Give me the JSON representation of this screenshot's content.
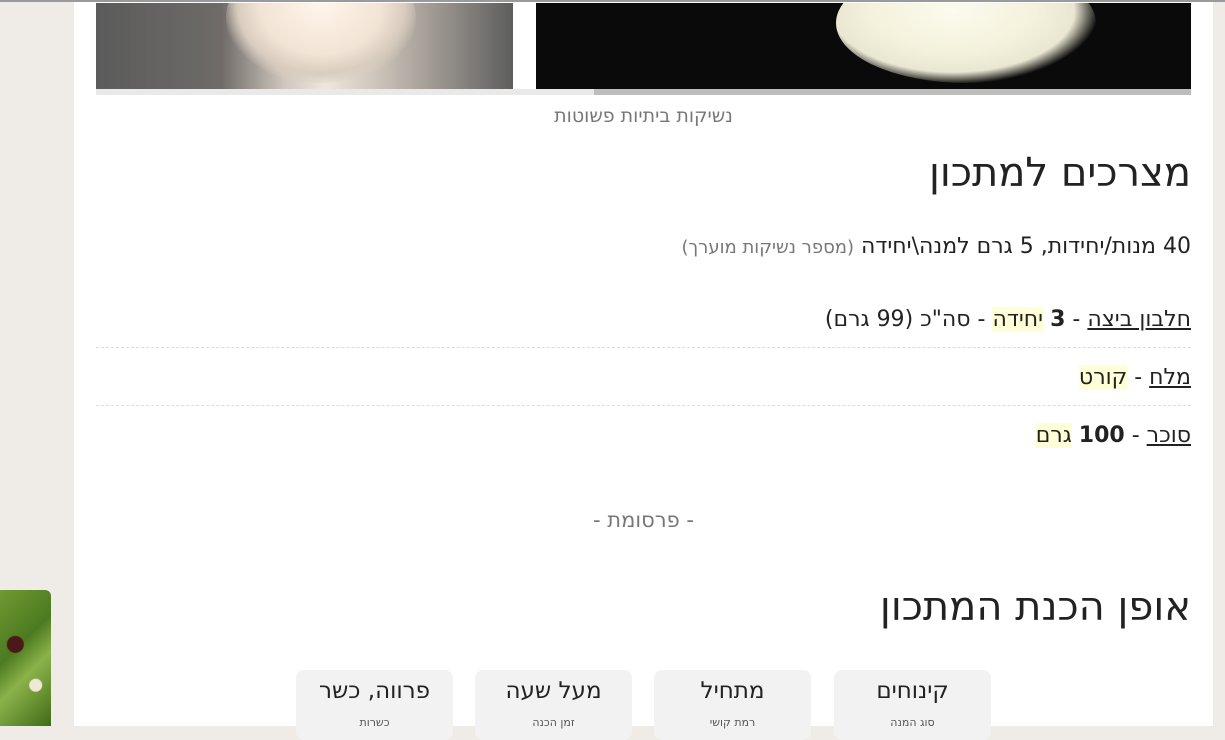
{
  "image_caption": "נשיקות ביתיות פשוטות",
  "ingredients_section": {
    "title": "מצרכים למתכון",
    "servings_text": "40 מנות/יחידות, 5 גרם למנה\\יחידה",
    "servings_note": "(מספר נשיקות מוערך)",
    "items": [
      {
        "name": "חלבון ביצה",
        "dash": "-",
        "amount": "3",
        "unit": "יחידה",
        "extra": "- סה\"כ (99 גרם)"
      },
      {
        "name": "מלח",
        "dash": "-",
        "amount": "",
        "unit": "קורט",
        "extra": ""
      },
      {
        "name": "סוכר",
        "dash": "-",
        "amount": "100",
        "unit": "גרם",
        "extra": ""
      }
    ]
  },
  "ad_label": "- פרסומת -",
  "method_section": {
    "title": "אופן הכנת המתכון"
  },
  "info_tiles": [
    {
      "title": "קינוחים",
      "subtitle": "סוג המנה"
    },
    {
      "title": "מתחיל",
      "subtitle": "רמת קושי"
    },
    {
      "title": "מעל שעה",
      "subtitle": "זמן הכנה"
    },
    {
      "title": "פרווה, כשר",
      "subtitle": "כשרות"
    }
  ]
}
